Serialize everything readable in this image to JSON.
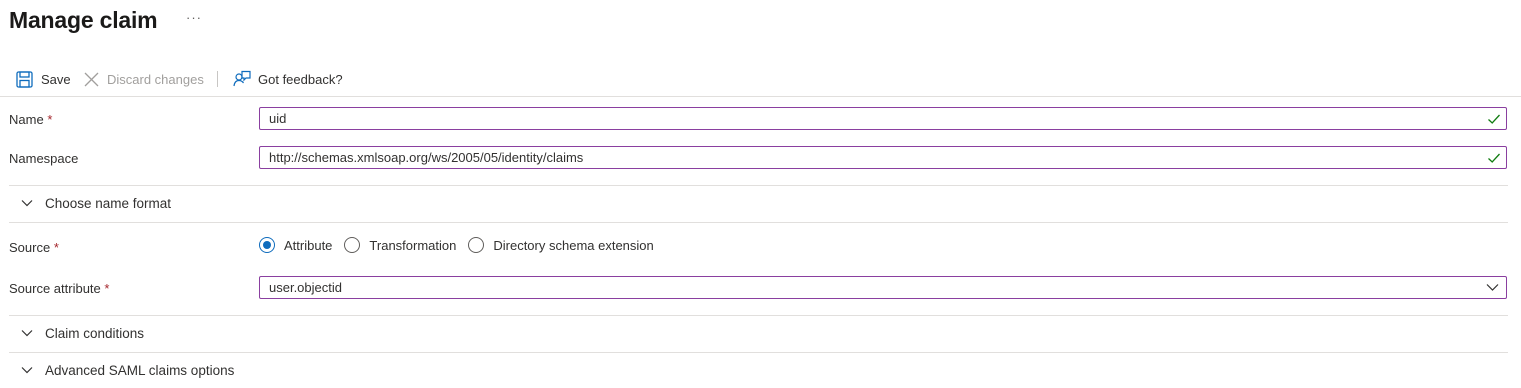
{
  "header": {
    "title": "Manage claim",
    "more_label": "···"
  },
  "toolbar": {
    "save_label": "Save",
    "discard_label": "Discard changes",
    "feedback_label": "Got feedback?"
  },
  "form": {
    "name": {
      "label": "Name",
      "required_mark": "*",
      "value": "uid"
    },
    "namespace": {
      "label": "Namespace",
      "value": "http://schemas.xmlsoap.org/ws/2005/05/identity/claims"
    },
    "name_format_section": "Choose name format",
    "source": {
      "label": "Source",
      "required_mark": "*",
      "options": [
        "Attribute",
        "Transformation",
        "Directory schema extension"
      ],
      "selected": "Attribute"
    },
    "source_attribute": {
      "label": "Source attribute",
      "required_mark": "*",
      "value": "user.objectid"
    },
    "claim_conditions_section": "Claim conditions",
    "advanced_section": "Advanced SAML claims options"
  },
  "colors": {
    "accent": "#0f6cbd",
    "field_border": "#8a3fa0",
    "valid_check": "#107c10",
    "required": "#a4262c"
  }
}
